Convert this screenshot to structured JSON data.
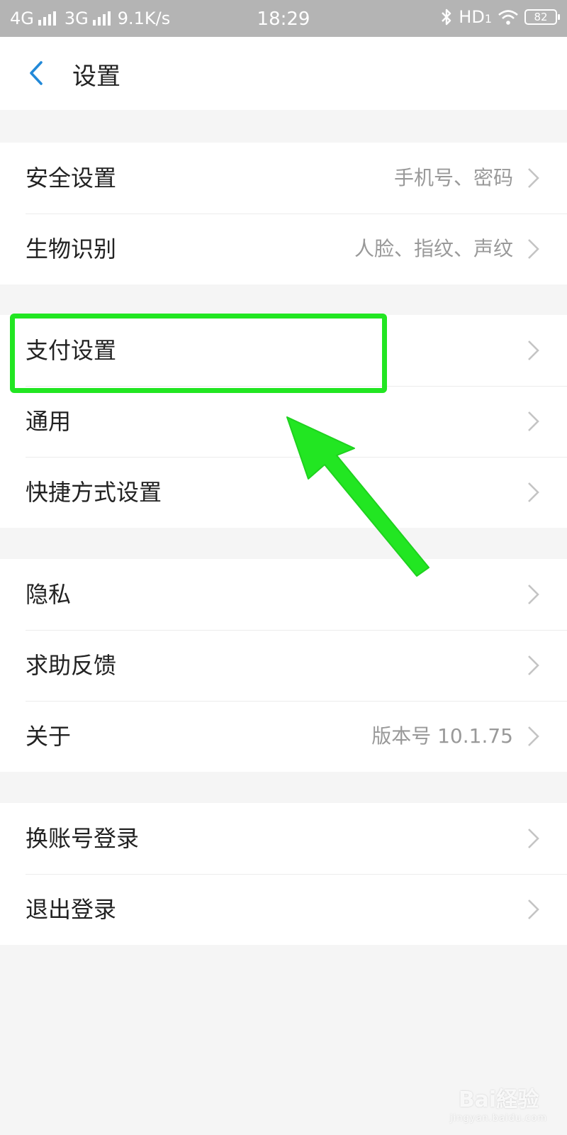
{
  "status_bar": {
    "network1": "4G",
    "network2": "3G",
    "speed": "9.1K/s",
    "time": "18:29",
    "hd_label": "HD",
    "hd_index": "1",
    "battery": "82"
  },
  "header": {
    "title": "设置"
  },
  "groups": [
    {
      "items": [
        {
          "label": "安全设置",
          "value": "手机号、密码"
        },
        {
          "label": "生物识别",
          "value": "人脸、指纹、声纹"
        }
      ]
    },
    {
      "items": [
        {
          "label": "支付设置",
          "value": ""
        },
        {
          "label": "通用",
          "value": ""
        },
        {
          "label": "快捷方式设置",
          "value": ""
        }
      ]
    },
    {
      "items": [
        {
          "label": "隐私",
          "value": ""
        },
        {
          "label": "求助反馈",
          "value": ""
        },
        {
          "label": "关于",
          "value": "版本号 10.1.75"
        }
      ]
    },
    {
      "items": [
        {
          "label": "换账号登录",
          "value": ""
        },
        {
          "label": "退出登录",
          "value": ""
        }
      ]
    }
  ],
  "annotation": {
    "color": "#22e622",
    "highlighted_item": "支付设置"
  },
  "watermark": {
    "main": "Bai経验",
    "sub": "jingyan.baidu.com"
  },
  "icons": [
    "back-arrow-icon",
    "chevron-right-icon",
    "bluetooth-icon",
    "wifi-icon",
    "battery-icon",
    "signal-bars-icon"
  ]
}
